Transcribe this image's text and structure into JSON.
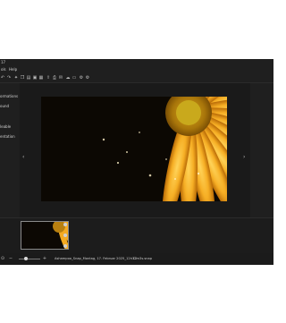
{
  "window": {
    "title": "17"
  },
  "menu": {
    "items": [
      "ols",
      "Help"
    ]
  },
  "sidebar": {
    "items": [
      "ormations",
      "ound",
      "leable",
      "entation"
    ]
  },
  "toolbar": {
    "icons": [
      "undo-icon",
      "redo-icon",
      "effects-icon",
      "copy-icon",
      "clipboard-icon",
      "picture-icon",
      "text-icon",
      "export-icon",
      "print-icon",
      "email-icon",
      "upload-icon",
      "folder-icon",
      "settings-icon"
    ]
  },
  "viewer": {
    "image_description": "orange gerbera flower with water droplets"
  },
  "filmstrip": {
    "selected_index": 0,
    "thumbnail_count": 1
  },
  "status": {
    "filename": "Ashampoo_Snap_Montag, 17. Februar 2025_12h32m3s.snap"
  },
  "colors": {
    "background": "#1f1f1f",
    "accent": "#f2a51c"
  }
}
